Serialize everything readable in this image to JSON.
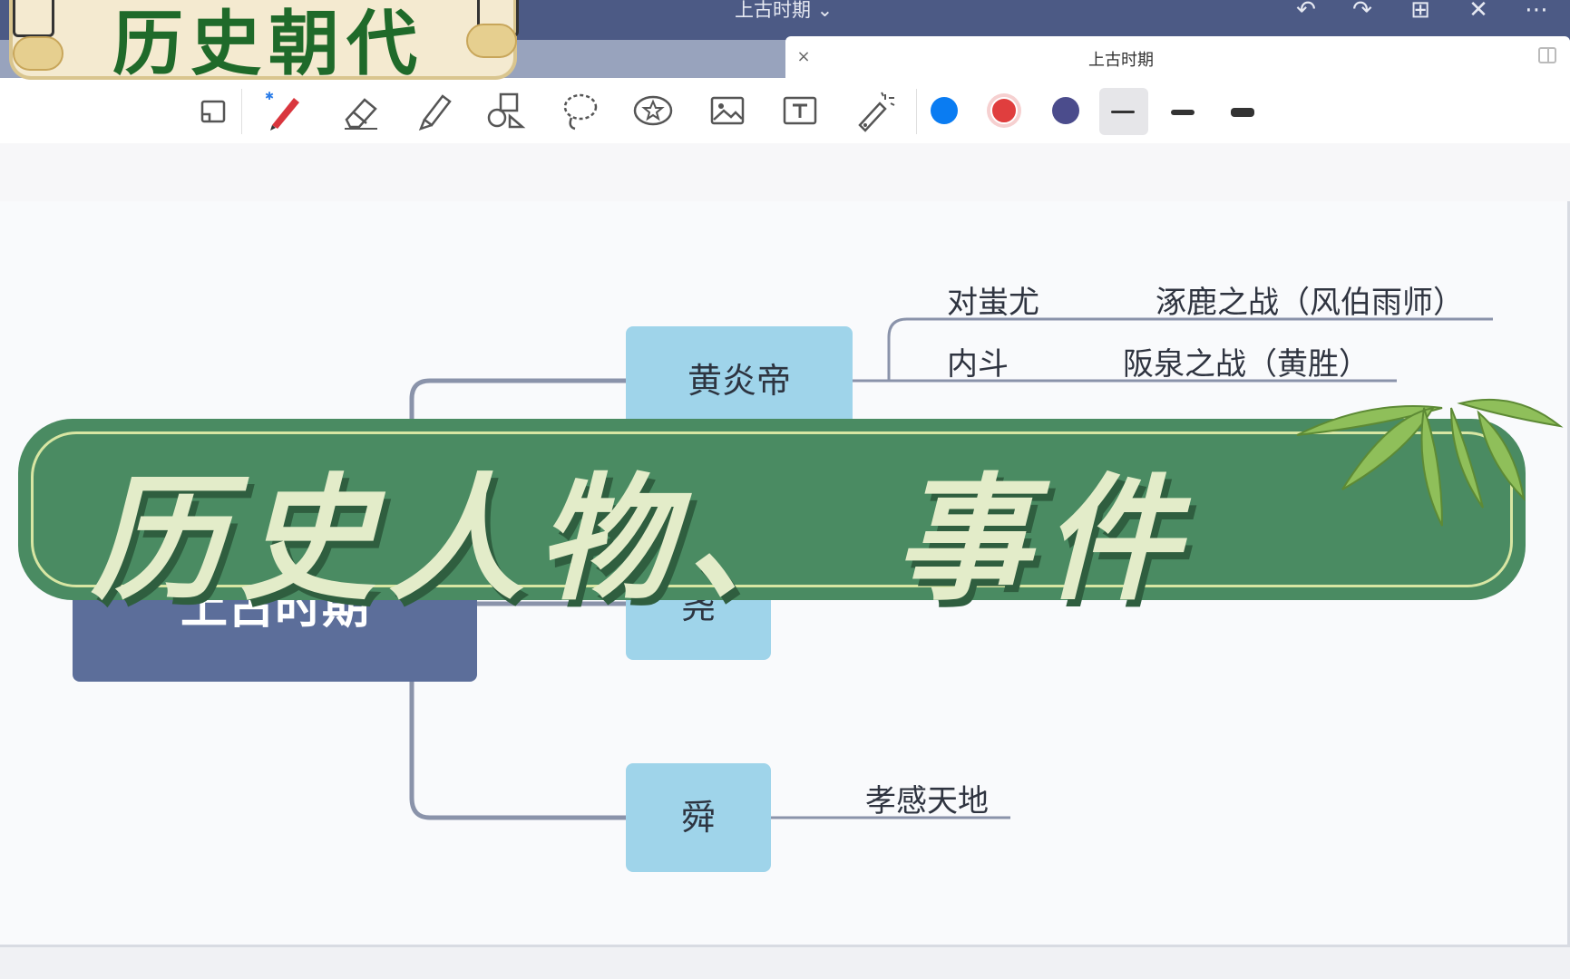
{
  "window": {
    "title": "上古时期 ⌄"
  },
  "tab": {
    "close_glyph": "×",
    "title": "上古时期"
  },
  "toolbar": {
    "tools": [
      "page-thumbnail-icon",
      "pen-icon",
      "eraser-icon",
      "highlighter-icon",
      "shapes-icon",
      "lasso-icon",
      "sticker-icon",
      "image-icon",
      "text-box-icon",
      "laser-pointer-icon"
    ],
    "colors": [
      "#0a7cf2",
      "#e03e3e",
      "#4b4c8c"
    ],
    "selected_color": "#e03e3e",
    "stroke_widths": [
      "thin",
      "medium",
      "thick"
    ],
    "selected_stroke": "thin"
  },
  "mindmap": {
    "root": "上古时期",
    "branches": [
      {
        "label": "黄炎帝",
        "children": [
          {
            "col1": "对蚩尤",
            "col2": "涿鹿之战（风伯雨师）"
          },
          {
            "col1": "内斗",
            "col2": "阪泉之战（黄胜）"
          }
        ]
      },
      {
        "label": "尧",
        "children": []
      },
      {
        "label": "舜",
        "children": [
          {
            "col1": "孝感天地"
          }
        ]
      }
    ]
  },
  "overlays": {
    "logo_text": "历史朝代",
    "banner_text": "历史人物、 事件"
  }
}
